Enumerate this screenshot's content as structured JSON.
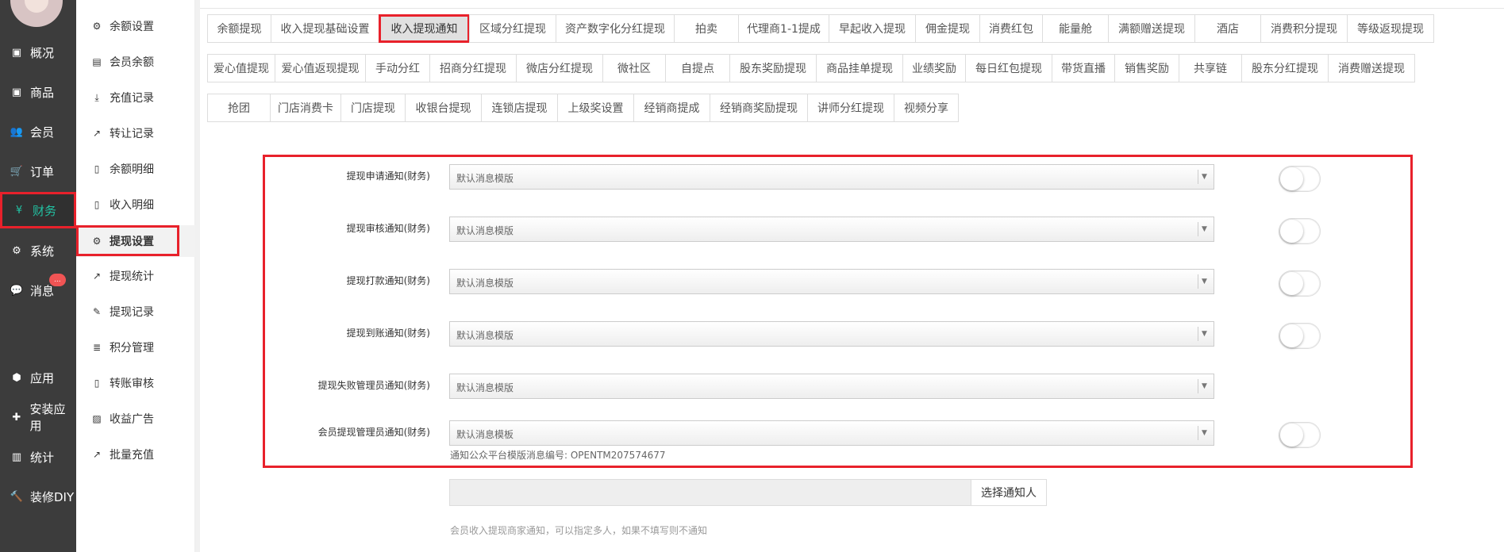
{
  "main_nav": {
    "items": [
      {
        "label": "概况",
        "icon": "dashboard-icon",
        "glyph": "▣"
      },
      {
        "label": "商品",
        "icon": "goods-icon",
        "glyph": "▣"
      },
      {
        "label": "会员",
        "icon": "users-icon",
        "glyph": "👥"
      },
      {
        "label": "订单",
        "icon": "cart-icon",
        "glyph": "🛒"
      },
      {
        "label": "财务",
        "icon": "yen-icon",
        "glyph": "¥"
      },
      {
        "label": "系统",
        "icon": "gears-icon",
        "glyph": "⚙"
      },
      {
        "label": "消息",
        "icon": "message-icon",
        "glyph": "💬"
      },
      {
        "label": "应用",
        "icon": "apps-icon",
        "glyph": "⬢"
      },
      {
        "label": "安装应用",
        "icon": "puzzle-icon",
        "glyph": "✚"
      },
      {
        "label": "统计",
        "icon": "bar-chart-icon",
        "glyph": "▥"
      },
      {
        "label": "装修DIY",
        "icon": "hammer-icon",
        "glyph": "🔨"
      }
    ],
    "message_badge": "...",
    "active_color": "#22c1a2"
  },
  "sub_nav": {
    "items": [
      {
        "label": "余额设置",
        "glyph": "⚙"
      },
      {
        "label": "会员余额",
        "glyph": "▤"
      },
      {
        "label": "充值记录",
        "glyph": "⤓"
      },
      {
        "label": "转让记录",
        "glyph": "↗"
      },
      {
        "label": "余额明细",
        "glyph": "▯"
      },
      {
        "label": "收入明细",
        "glyph": "▯"
      },
      {
        "label": "提现设置",
        "glyph": "⚙"
      },
      {
        "label": "提现统计",
        "glyph": "↗"
      },
      {
        "label": "提现记录",
        "glyph": "✎"
      },
      {
        "label": "积分管理",
        "glyph": "≣"
      },
      {
        "label": "转账审核",
        "glyph": "▯"
      },
      {
        "label": "收益广告",
        "glyph": "▨"
      },
      {
        "label": "批量充值",
        "glyph": "↗"
      }
    ]
  },
  "tabs": {
    "row1": [
      "余额提现",
      "收入提现基础设置",
      "收入提现通知",
      "区域分红提现",
      "资产数字化分红提现",
      "拍卖",
      "代理商1-1提成",
      "早起收入提现",
      "佣金提现",
      "消费红包",
      "能量舱",
      "满额赠送提现",
      "酒店",
      "消费积分提现",
      "等级返现提现"
    ],
    "row2": [
      "爱心值提现",
      "爱心值返现提现",
      "手动分红",
      "招商分红提现",
      "微店分红提现",
      "微社区",
      "自提点",
      "股东奖励提现",
      "商品挂单提现",
      "业绩奖励",
      "每日红包提现",
      "带货直播",
      "销售奖励",
      "共享链",
      "股东分红提现",
      "消费赠送提现"
    ],
    "row3": [
      "抢团",
      "门店消费卡",
      "门店提现",
      "收银台提现",
      "连锁店提现",
      "上级奖设置",
      "经销商提成",
      "经销商奖励提现",
      "讲师分红提现",
      "视频分享"
    ]
  },
  "form": {
    "fields": [
      {
        "label": "提现申请通知(财务)",
        "value": "默认消息模版"
      },
      {
        "label": "提现审核通知(财务)",
        "value": "默认消息模版"
      },
      {
        "label": "提现打款通知(财务)",
        "value": "默认消息模版"
      },
      {
        "label": "提现到账通知(财务)",
        "value": "默认消息模版"
      },
      {
        "label": "提现失败管理员通知(财务)",
        "value": "默认消息模版"
      },
      {
        "label": "会员提现管理员通知(财务)",
        "value": "默认消息模板"
      }
    ],
    "template_hint": "通知公众平台模版消息编号: OPENTM207574677",
    "select_notifier_label": "选择通知人",
    "notifier_hint": "会员收入提现商家通知，可以指定多人，如果不填写则不通知"
  }
}
